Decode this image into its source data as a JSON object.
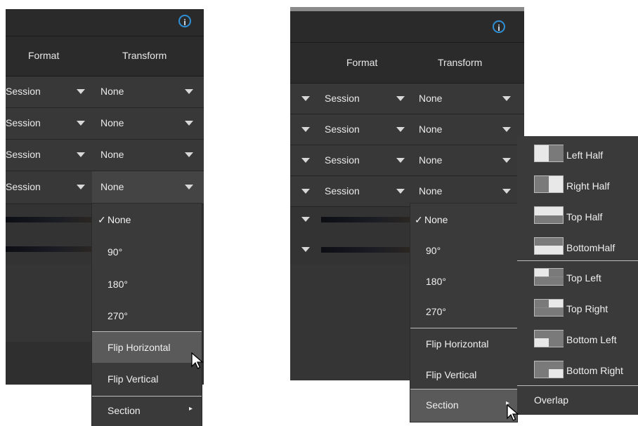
{
  "info_label": "i",
  "columns": {
    "format": "Format",
    "transform": "Transform"
  },
  "rows": [
    {
      "format": "Session",
      "transform": "None"
    },
    {
      "format": "Session",
      "transform": "None"
    },
    {
      "format": "Session",
      "transform": "None"
    },
    {
      "format": "Session",
      "transform": "None"
    }
  ],
  "transform_menu": {
    "checkmark": "✓",
    "items": [
      "None",
      "90°",
      "180°",
      "270°",
      "Flip Horizontal",
      "Flip Vertical",
      "Section"
    ],
    "selected": "None",
    "submenu_arrow": "▸"
  },
  "section_submenu": {
    "items": [
      "Left Half",
      "Right Half",
      "Top Half",
      "BottomHalf",
      "Top Left",
      "Top Right",
      "Bottom Left",
      "Bottom Right",
      "Overlap"
    ]
  },
  "colors": {
    "info_accent": "#2e8fd6",
    "panel": "#2f2f2f",
    "menu": "#3a3a3a",
    "highlight": "#5a5a5a"
  }
}
